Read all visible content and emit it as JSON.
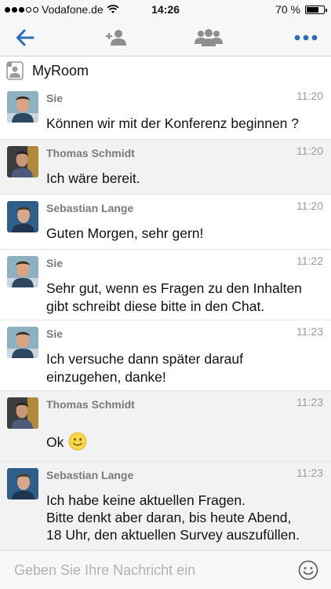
{
  "status_bar": {
    "carrier": "Vodafone.de",
    "time": "14:26",
    "battery_text": "70 %",
    "battery_level": 0.7,
    "signal_bars": 3
  },
  "toolbar": {
    "accent_color": "#2a6ebb",
    "icon_color": "#8e8e8e",
    "icons": [
      "back-arrow-icon",
      "add-person-icon",
      "group-icon",
      "more-icon"
    ]
  },
  "room": {
    "name": "MyRoom"
  },
  "messages": [
    {
      "sender": "Sie",
      "time": "11:20",
      "text": "Können wir mit der Konferenz beginnen ?",
      "avatar": "sie"
    },
    {
      "sender": "Thomas Schmidt",
      "time": "11:20",
      "text": "Ich wäre bereit.",
      "avatar": "thomas"
    },
    {
      "sender": "Sebastian Lange",
      "time": "11:20",
      "text": "Guten Morgen, sehr gern!",
      "avatar": "sebastian"
    },
    {
      "sender": "Sie",
      "time": "11:22",
      "text": "Sehr gut, wenn es Fragen zu den Inhalten\ngibt schreibt diese bitte in den Chat.",
      "avatar": "sie"
    },
    {
      "sender": "Sie",
      "time": "11:23",
      "text": "Ich versuche dann später darauf\neinzugehen, danke!",
      "avatar": "sie"
    },
    {
      "sender": "Thomas Schmidt",
      "time": "11:23",
      "text": "Ok",
      "avatar": "thomas",
      "emoji": "slightly-smiling-face"
    },
    {
      "sender": "Sebastian Lange",
      "time": "11:23",
      "text": "Ich habe keine aktuellen Fragen.\nBitte denkt aber daran, bis heute Abend,\n18 Uhr, den aktuellen Survey auszufüllen.",
      "avatar": "sebastian"
    }
  ],
  "input": {
    "placeholder": "Geben Sie Ihre Nachricht ein",
    "value": ""
  }
}
